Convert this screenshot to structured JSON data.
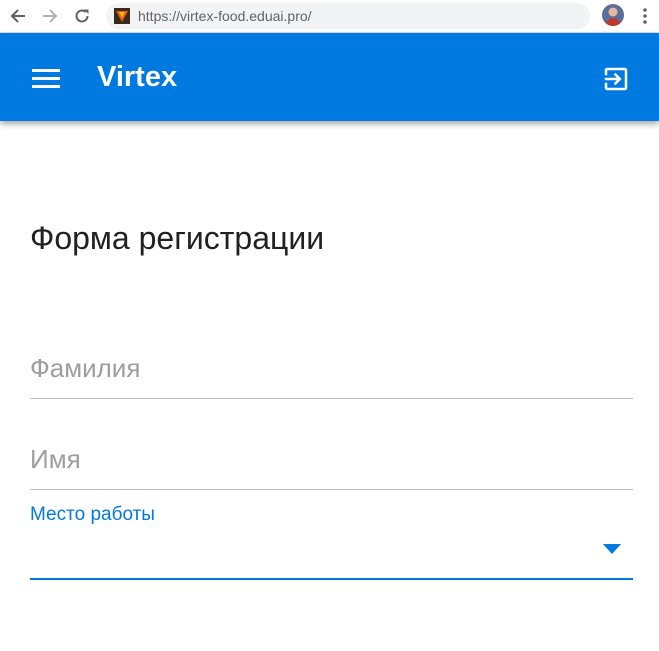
{
  "browser": {
    "url": "https://virtex-food.eduai.pro/"
  },
  "app_bar": {
    "title": "Virtex",
    "color": "#0079e0"
  },
  "form": {
    "title": "Форма регистрации",
    "surname_placeholder": "Фамилия",
    "name_placeholder": "Имя",
    "workplace_label": "Место работы",
    "workplace_value": ""
  },
  "icons": {
    "back": "arrow-back-icon",
    "forward": "arrow-forward-icon",
    "reload": "reload-icon",
    "menu": "hamburger-menu-icon",
    "logout": "exit-to-app-icon",
    "dropdown": "caret-down-icon"
  }
}
